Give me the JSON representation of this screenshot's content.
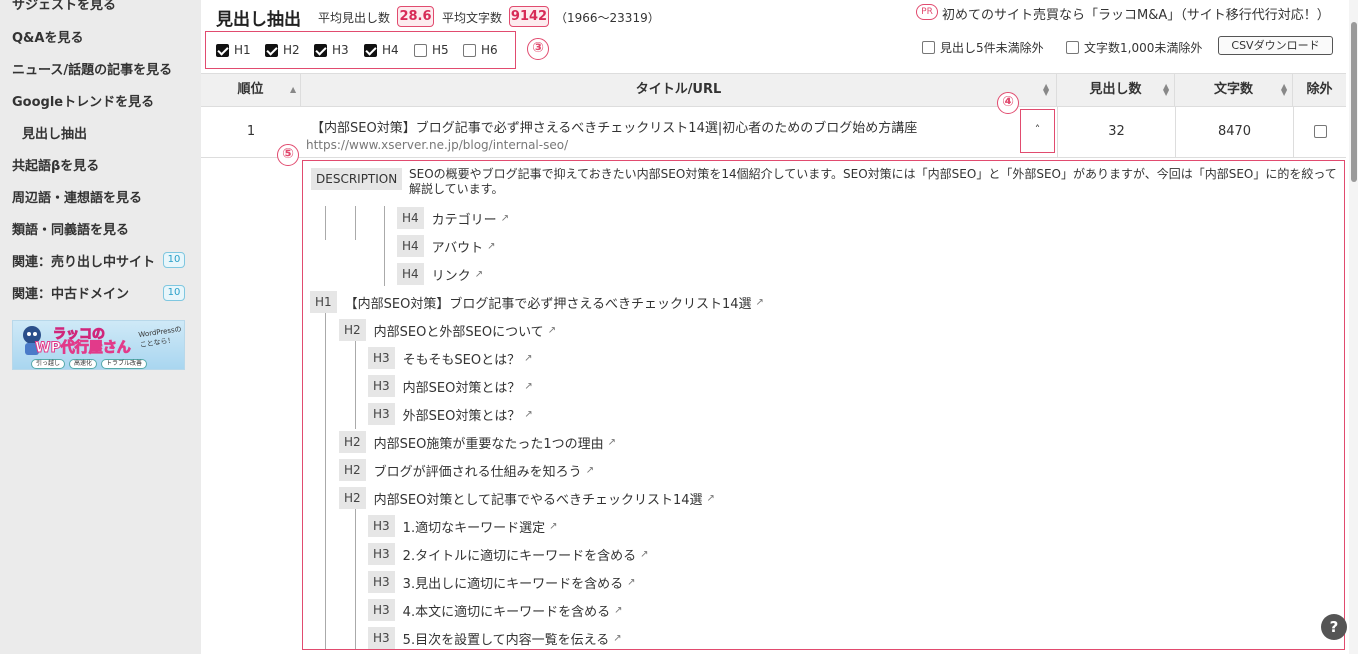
{
  "sidebar": {
    "items": [
      {
        "label": "サジェストを見る"
      },
      {
        "label": "Q&Aを見る"
      },
      {
        "label": "ニュース/話題の記事を見る"
      },
      {
        "label": "Googleトレンドを見る"
      },
      {
        "label": "見出し抽出"
      },
      {
        "label": "共起語βを見る"
      },
      {
        "label": "周辺語・連想語を見る"
      },
      {
        "label": "類語・同義語を見る"
      },
      {
        "label": "関連：売り出し中サイト",
        "badge": "10"
      },
      {
        "label": "関連：中古ドメイン",
        "badge": "10"
      }
    ],
    "banner": {
      "line1": "ラッコの",
      "line2": "WP代行屋さん",
      "side": "WordPressのことなら！",
      "pills": [
        "引っ越し",
        "高速化",
        "トラブル改善"
      ]
    }
  },
  "header": {
    "title": "見出し抽出",
    "avg_headings_label": "平均見出し数",
    "avg_headings": "28.6",
    "avg_chars_label": "平均文字数",
    "avg_chars": "9142",
    "range": "（1966〜23319）"
  },
  "heading_filters": [
    {
      "label": "H1",
      "checked": true
    },
    {
      "label": "H2",
      "checked": true
    },
    {
      "label": "H3",
      "checked": true
    },
    {
      "label": "H4",
      "checked": true
    },
    {
      "label": "H5",
      "checked": false
    },
    {
      "label": "H6",
      "checked": false
    }
  ],
  "annotations": {
    "n3": "③",
    "n4": "④",
    "n5": "⑤"
  },
  "promo": {
    "badge": "PR",
    "text": "初めてのサイト売買なら「ラッコM&A」（サイト移行代行対応！）"
  },
  "options": {
    "exclude_headings": "見出し5件未満除外",
    "exclude_chars": "文字数1,000未満除外",
    "csv_button": "CSVダウンロード"
  },
  "table": {
    "columns": {
      "rank": "順位",
      "title": "タイトル/URL",
      "headings": "見出し数",
      "chars": "文字数",
      "exclude": "除外"
    },
    "row": {
      "rank": "1",
      "title": "【内部SEO対策】ブログ記事で必ず押さえるべきチェックリスト14選|初心者のためのブログ始め方講座",
      "url": "https://www.xserver.ne.jp/blog/internal-seo/",
      "toggle": "˄",
      "headings": "32",
      "chars": "8470"
    }
  },
  "detail": {
    "desc_badge": "DESCRIPTION",
    "description": "SEOの概要やブログ記事で抑えておきたい内部SEO対策を14個紹介しています。SEO対策には「内部SEO」と「外部SEO」がありますが、今回は「内部SEO」に的を絞って解説しています。",
    "headings": [
      {
        "tag": "H4",
        "text": "カテゴリー"
      },
      {
        "tag": "H4",
        "text": "アバウト"
      },
      {
        "tag": "H4",
        "text": "リンク"
      },
      {
        "tag": "H1",
        "text": "【内部SEO対策】ブログ記事で必ず押さえるべきチェックリスト14選"
      },
      {
        "tag": "H2",
        "text": "内部SEOと外部SEOについて"
      },
      {
        "tag": "H3",
        "text": "そもそもSEOとは？"
      },
      {
        "tag": "H3",
        "text": "内部SEO対策とは？"
      },
      {
        "tag": "H3",
        "text": "外部SEO対策とは？"
      },
      {
        "tag": "H2",
        "text": "内部SEO施策が重要なたった1つの理由"
      },
      {
        "tag": "H2",
        "text": "ブログが評価される仕組みを知ろう"
      },
      {
        "tag": "H2",
        "text": "内部SEO対策として記事でやるべきチェックリスト14選"
      },
      {
        "tag": "H3",
        "text": "1.適切なキーワード選定"
      },
      {
        "tag": "H3",
        "text": "2.タイトルに適切にキーワードを含める"
      },
      {
        "tag": "H3",
        "text": "3.見出しに適切にキーワードを含める"
      },
      {
        "tag": "H3",
        "text": "4.本文に適切にキーワードを含める"
      },
      {
        "tag": "H3",
        "text": "5.目次を設置して内容一覧を伝える"
      }
    ]
  },
  "help": "?"
}
